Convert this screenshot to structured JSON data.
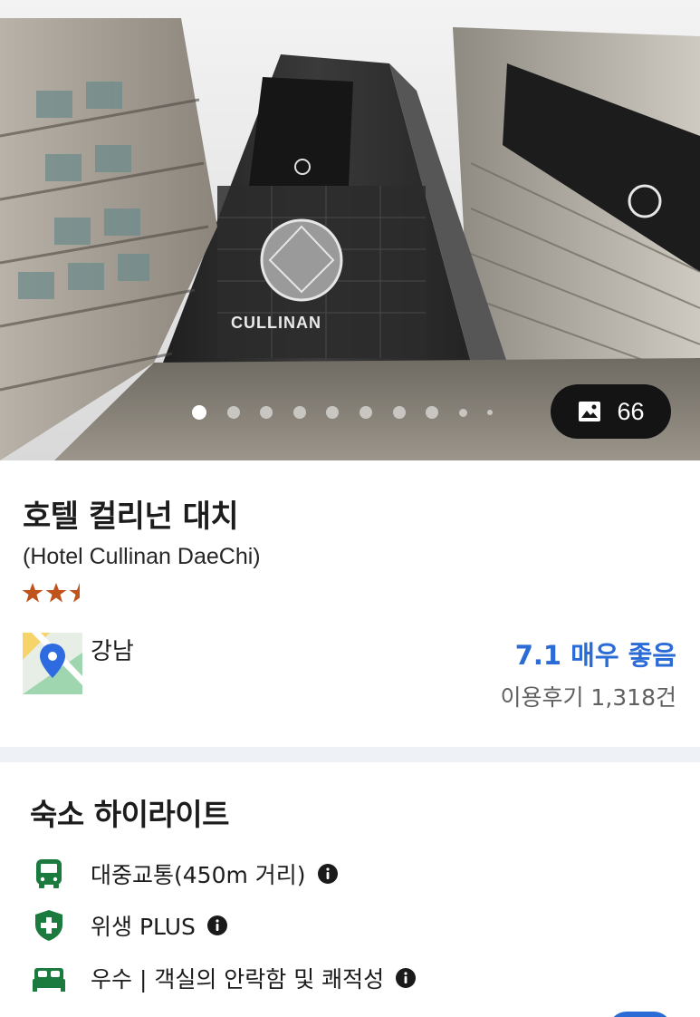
{
  "gallery": {
    "photo_count": "66",
    "dot_count": 10,
    "active_index": 0,
    "sign_text": "CULLINAN"
  },
  "hotel": {
    "name": "호텔 컬리넌 대치",
    "name_en": "(Hotel Cullinan DaeChi)",
    "stars": 2.5,
    "area": "강남"
  },
  "rating": {
    "score_text": "7.1 매우 좋음",
    "reviews": "이용후기 1,318건"
  },
  "highlights": {
    "title": "숙소 하이라이트",
    "items": [
      {
        "icon": "bus-icon",
        "text": "대중교통(450m 거리)"
      },
      {
        "icon": "shield-plus-icon",
        "text": "위생 PLUS"
      },
      {
        "icon": "bed-icon",
        "text": "우수 | 객실의 안락함 및 쾌적성"
      }
    ]
  },
  "colors": {
    "accent_blue": "#2b6bd6",
    "green": "#1b7a3e",
    "star": "#c0521b",
    "divider": "#eef1f6"
  }
}
